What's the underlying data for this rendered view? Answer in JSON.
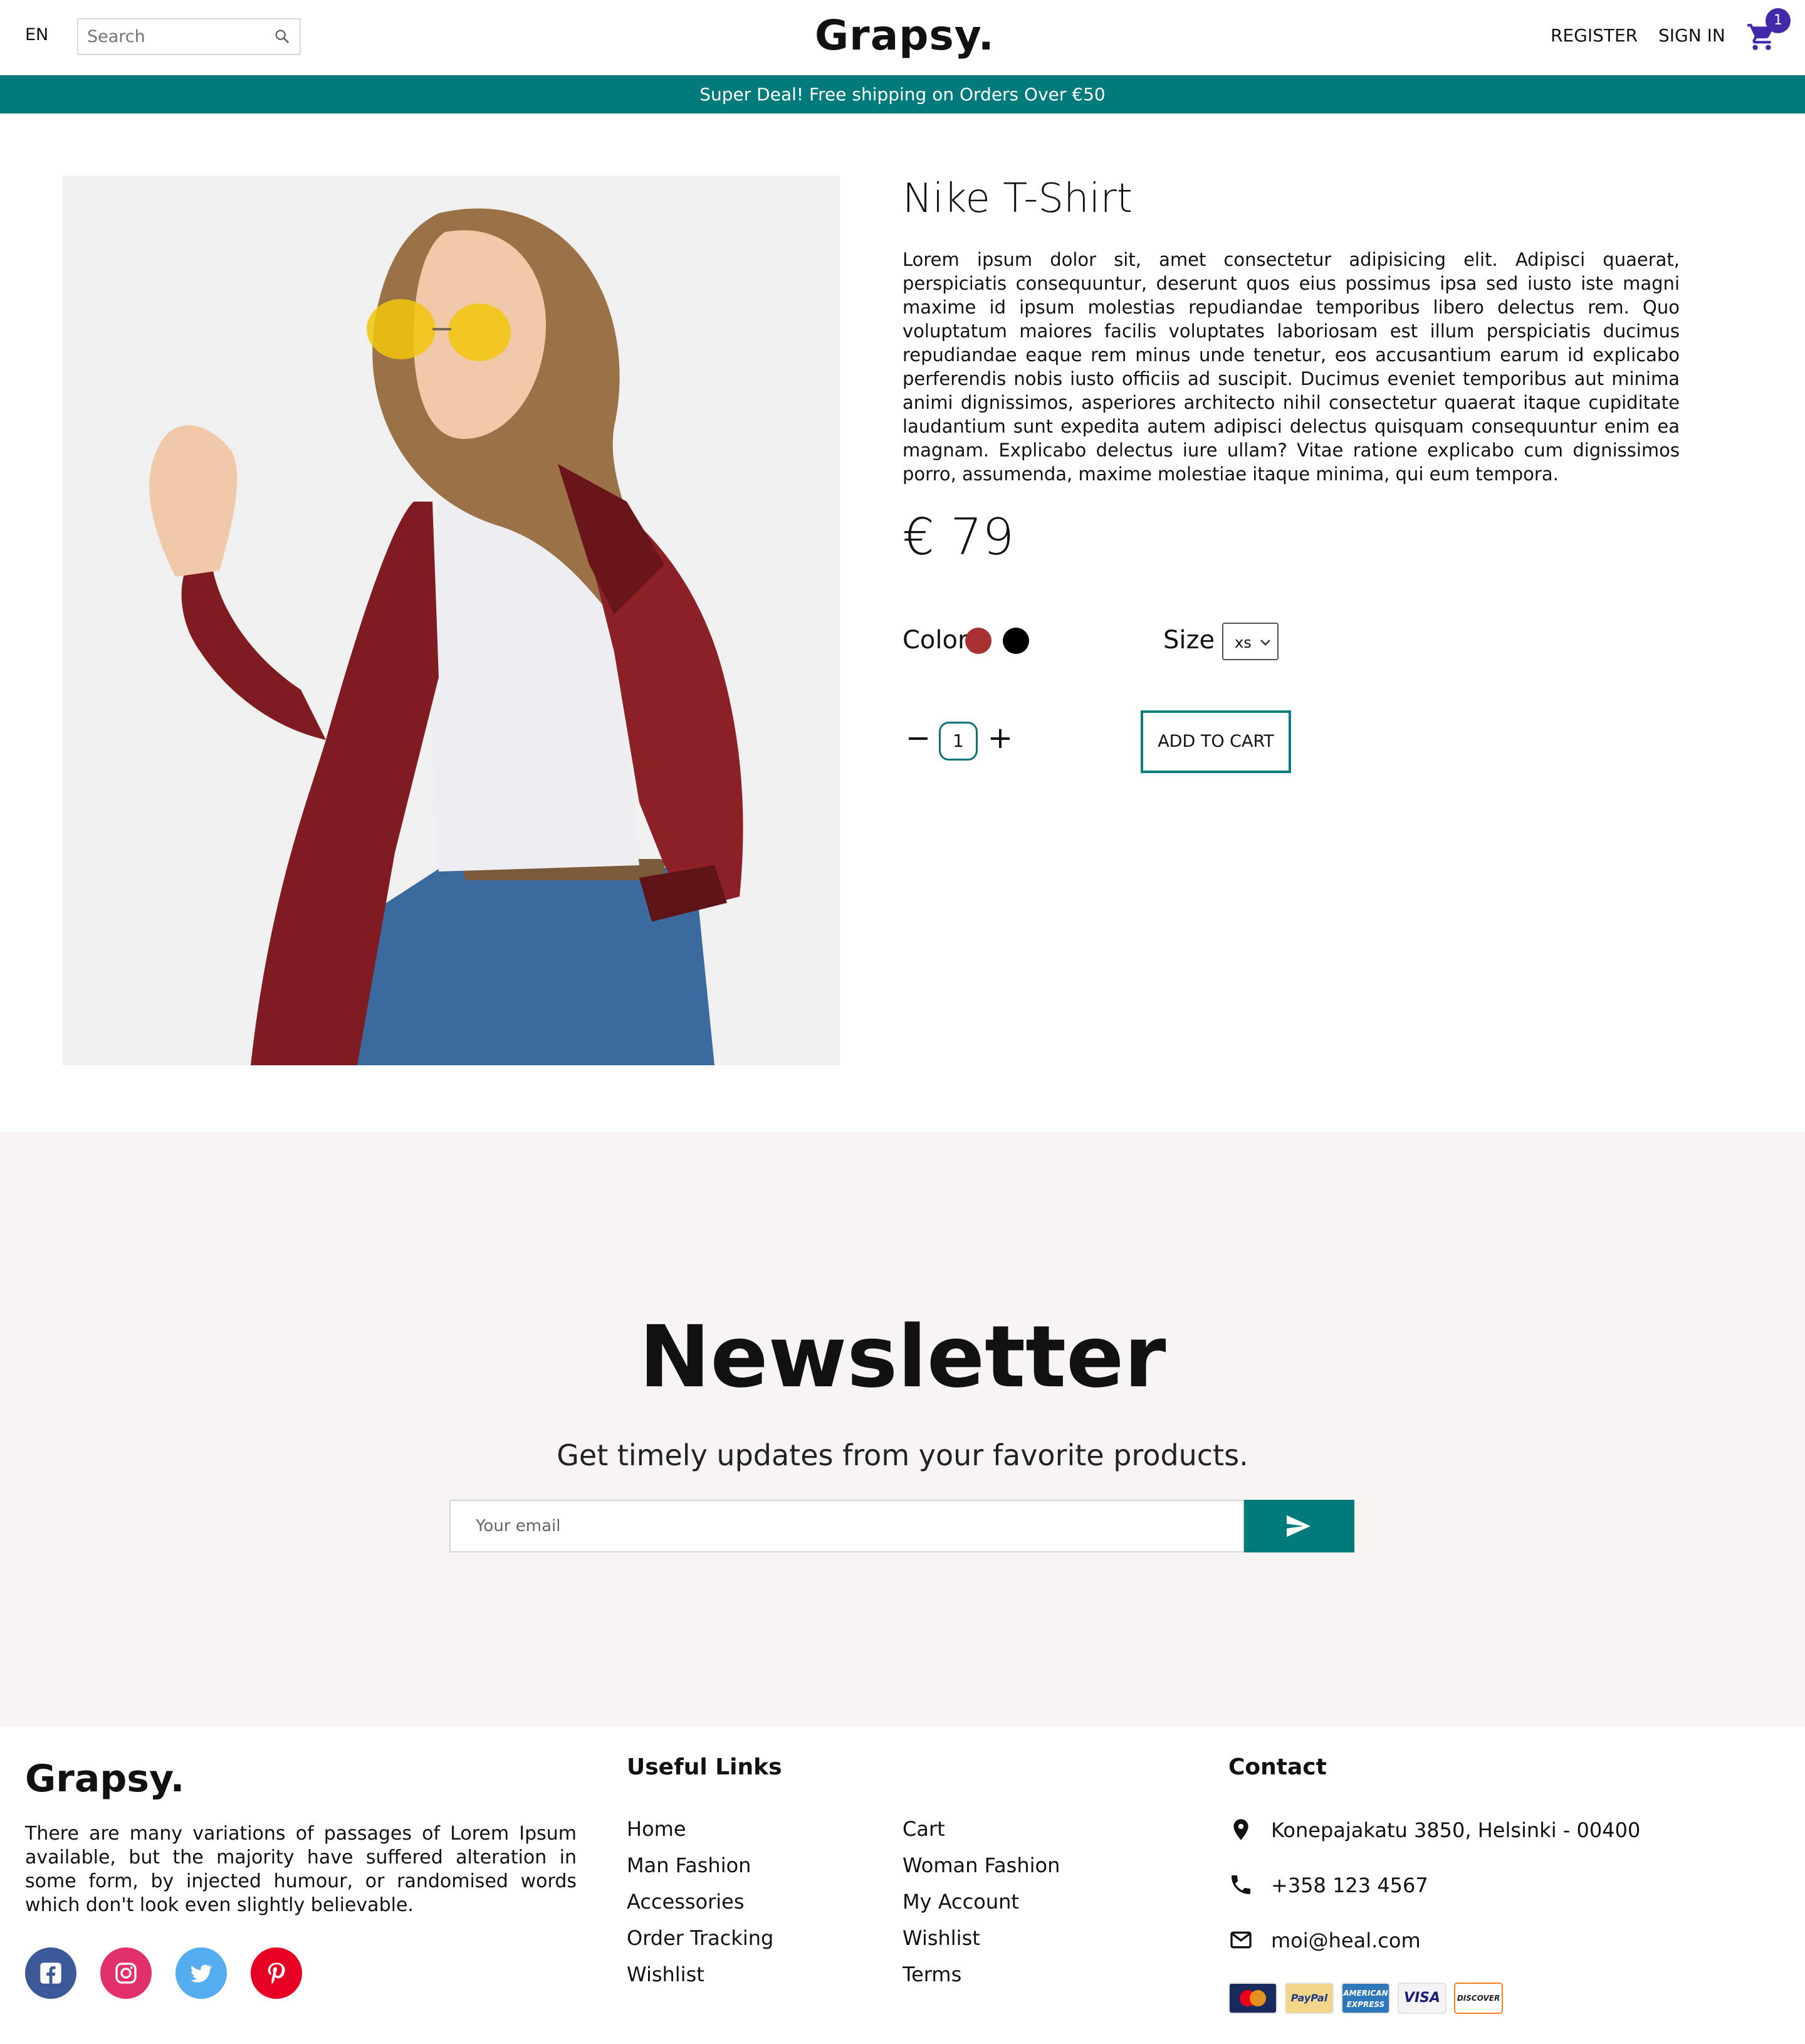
{
  "header": {
    "language": "EN",
    "search_placeholder": "Search",
    "logo": "Grapsy.",
    "register_label": "REGISTER",
    "signin_label": "SIGN IN",
    "cart_count": "1"
  },
  "promo": {
    "text": "Super Deal! Free shipping on Orders Over €50"
  },
  "product": {
    "title": "Nike T-Shirt",
    "description": "Lorem ipsum dolor sit, amet consectetur adipisicing elit. Adipisci quaerat, perspiciatis consequuntur, deserunt quos eius possimus ipsa sed iusto iste magni maxime id ipsum molestias repudiandae temporibus libero delectus rem. Quo voluptatum maiores facilis voluptates laboriosam est illum perspiciatis ducimus repudiandae eaque rem minus unde tenetur, eos accusantium earum id explicabo perferendis nobis iusto officiis ad suscipit. Ducimus eveniet temporibus aut minima animi dignissimos, asperiores architecto nihil consectetur quaerat itaque cupiditate laudantium sunt expedita autem adipisci delectus quisquam consequuntur enim ea magnam. Explicabo delectus iure ullam? Vitae ratione explicabo cum dignissimos porro, assumenda, maxime molestiae itaque minima, qui eum tempora.",
    "price": "€ 79",
    "color_label": "Color",
    "colors": [
      "#a83232",
      "#000000"
    ],
    "size_label": "Size",
    "size_selected": "xs",
    "quantity": "1",
    "minus_label": "−",
    "plus_label": "+",
    "add_to_cart_label": "ADD TO CART",
    "image_icon": "woman-red-leather-jacket-photo"
  },
  "newsletter": {
    "title": "Newsletter",
    "subtitle": "Get timely updates from your favorite products.",
    "email_placeholder": "Your email",
    "submit_icon": "send-icon"
  },
  "footer": {
    "logo": "Grapsy.",
    "about": "There are many variations of passages of Lorem Ipsum available, but the majority have suffered alteration in some form, by injected humour, or randomised words which don't look even slightly believable.",
    "social": [
      "facebook",
      "instagram",
      "twitter",
      "pinterest"
    ],
    "useful_links_title": "Useful Links",
    "links_col1": [
      "Home",
      "Man Fashion",
      "Accessories",
      "Order Tracking",
      "Wishlist"
    ],
    "links_col2": [
      "Cart",
      "Woman Fashion",
      "My Account",
      "Wishlist",
      "Terms"
    ],
    "contact_title": "Contact",
    "address": "Konepajakatu 3850, Helsinki - 00400",
    "phone": "+358 123 4567",
    "email": "moi@heal.com",
    "payment_methods": [
      "mastercard",
      "paypal",
      "american-express",
      "visa",
      "discover"
    ],
    "colors": {
      "accent": "#007a7b",
      "cart_badge": "#4129a8",
      "newsletter_bg": "#f8f4f3"
    }
  }
}
